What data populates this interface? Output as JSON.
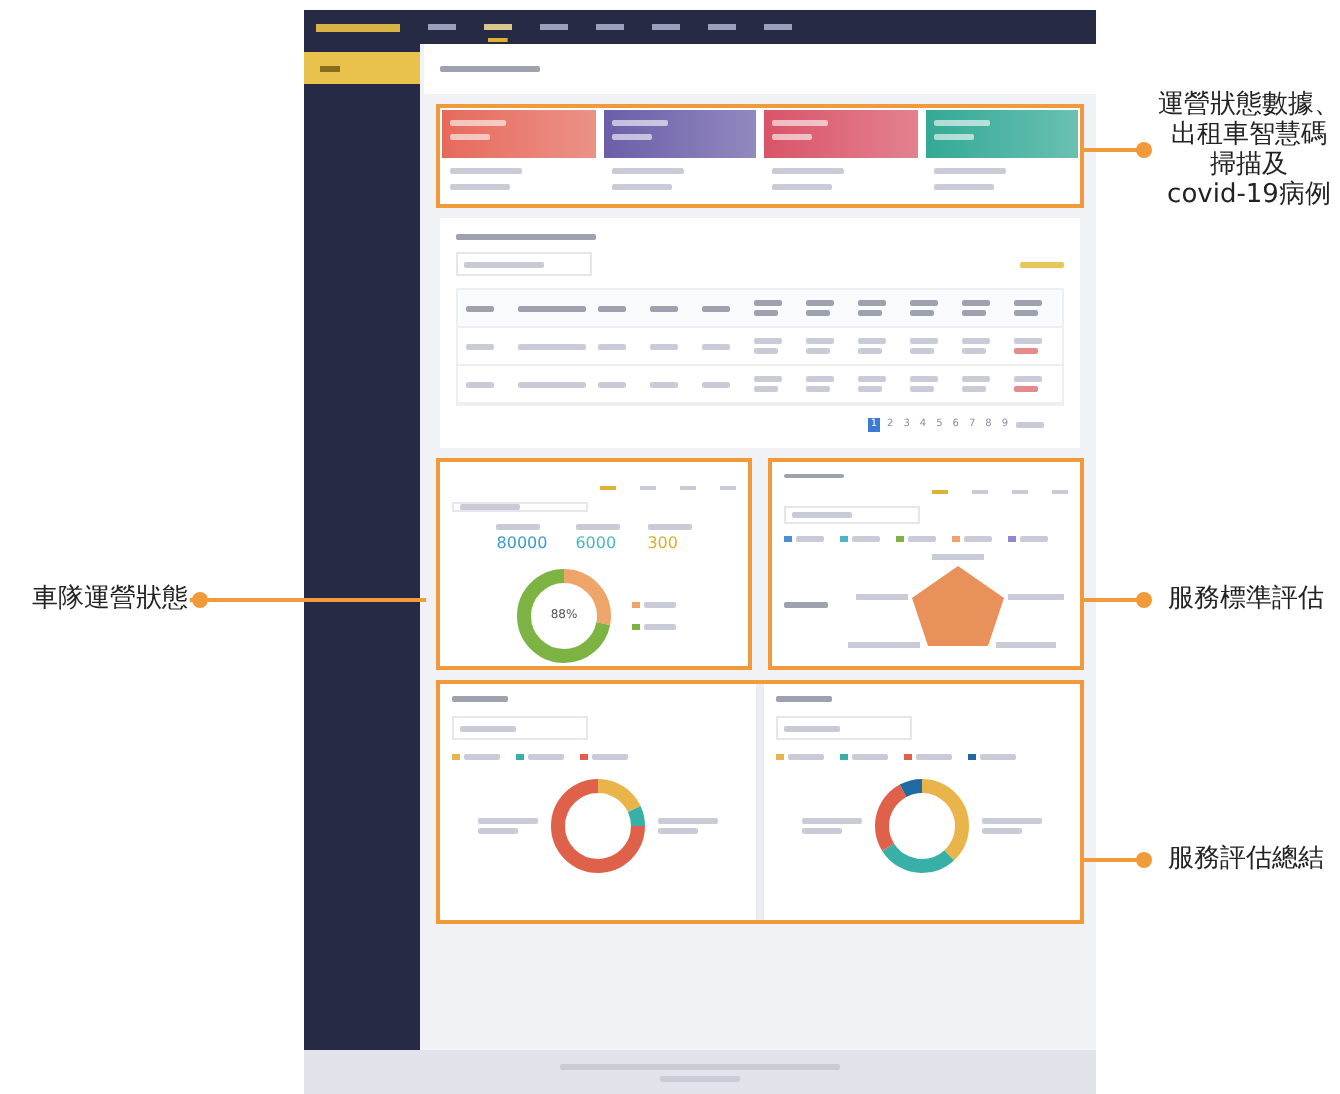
{
  "nav_items": [
    {
      "selected": false
    },
    {
      "selected": true
    },
    {
      "selected": false
    },
    {
      "selected": false
    },
    {
      "selected": false
    },
    {
      "selected": false
    },
    {
      "selected": false
    }
  ],
  "left_callouts": [
    {
      "lines": [
        "車隊運營狀態"
      ]
    }
  ],
  "right_callouts": [
    {
      "lines": [
        "運營狀態數據、",
        "出租車智慧碼",
        "掃描及",
        "covid-19病例"
      ]
    },
    {
      "lines": [
        "服務標準評估"
      ]
    },
    {
      "lines": [
        "服務評估總結"
      ]
    }
  ],
  "fleet_tabs": [
    {
      "selected": true
    },
    {
      "selected": false
    },
    {
      "selected": false
    },
    {
      "selected": false
    }
  ],
  "service_tabs": [
    {
      "selected": true
    },
    {
      "selected": false
    },
    {
      "selected": false
    },
    {
      "selected": false
    }
  ],
  "stat_cards": [
    {
      "color": "#e66a5c"
    },
    {
      "color": "#6b5ea8"
    },
    {
      "color": "#d95468"
    },
    {
      "color": "#34a996"
    }
  ],
  "fleet_figures": [
    {
      "value": "80000",
      "color": "#3a9cc8"
    },
    {
      "value": "6000",
      "color": "#4ab8c2"
    },
    {
      "value": "300",
      "color": "#dcae2c"
    }
  ],
  "fleet_donut": {
    "center": "88%"
  },
  "pagination": [
    {
      "label": "1",
      "selected": true
    },
    {
      "label": "2",
      "selected": false
    },
    {
      "label": "3",
      "selected": false
    },
    {
      "label": "4",
      "selected": false
    },
    {
      "label": "5",
      "selected": false
    },
    {
      "label": "6",
      "selected": false
    },
    {
      "label": "7",
      "selected": false
    },
    {
      "label": "8",
      "selected": false
    },
    {
      "label": "9",
      "selected": false
    }
  ]
}
